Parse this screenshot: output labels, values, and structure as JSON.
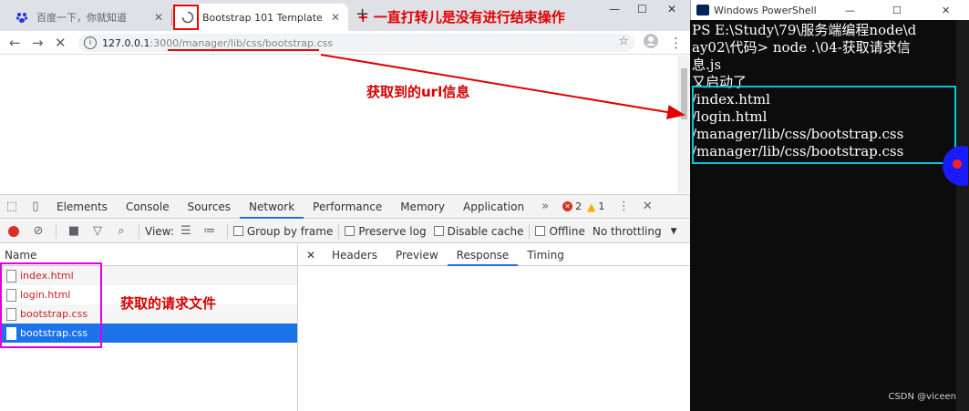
{
  "chrome": {
    "tabs": [
      {
        "title": "百度一下，你就知道",
        "icon": "paw-icon"
      },
      {
        "title": "Bootstrap 101 Template",
        "icon": "loading-spinner-icon"
      }
    ],
    "url_host": "127.0.0.1",
    "url_path": ":3000/manager/lib/css/bootstrap.css"
  },
  "devtools": {
    "tabs": [
      "Elements",
      "Console",
      "Sources",
      "Network",
      "Performance",
      "Memory",
      "Application"
    ],
    "selected_tab": "Network",
    "error_count": "2",
    "warning_count": "1",
    "toolbar": {
      "view_label": "View:",
      "group_by_frame": "Group by frame",
      "preserve_log": "Preserve log",
      "disable_cache": "Disable cache",
      "offline": "Offline",
      "throttling": "No throttling"
    },
    "name_header": "Name",
    "requests": [
      "index.html",
      "login.html",
      "bootstrap.css",
      "bootstrap.css"
    ],
    "detail_tabs": [
      "Headers",
      "Preview",
      "Response",
      "Timing"
    ],
    "detail_selected": "Response"
  },
  "powershell": {
    "title": "Windows PowerShell",
    "lines": [
      "PS E:\\Study\\79\\服务端编程node\\d",
      "ay02\\代码> node .\\04-获取请求信",
      "息.js",
      "又启动了",
      "/index.html",
      "/login.html",
      "/manager/lib/css/bootstrap.css",
      "/manager/lib/css/bootstrap.css"
    ]
  },
  "annotations": {
    "loading_note": "+ 一直打转儿是没有进行结束操作",
    "url_note": "获取到的url信息",
    "files_note": "获取的请求文件"
  },
  "watermark": "CSDN @viceen",
  "colors": {
    "annotation_red": "#e00000",
    "box_cyan": "#00c8d7",
    "box_magenta": "#e000e0",
    "selection_blue": "#1a73e8"
  }
}
